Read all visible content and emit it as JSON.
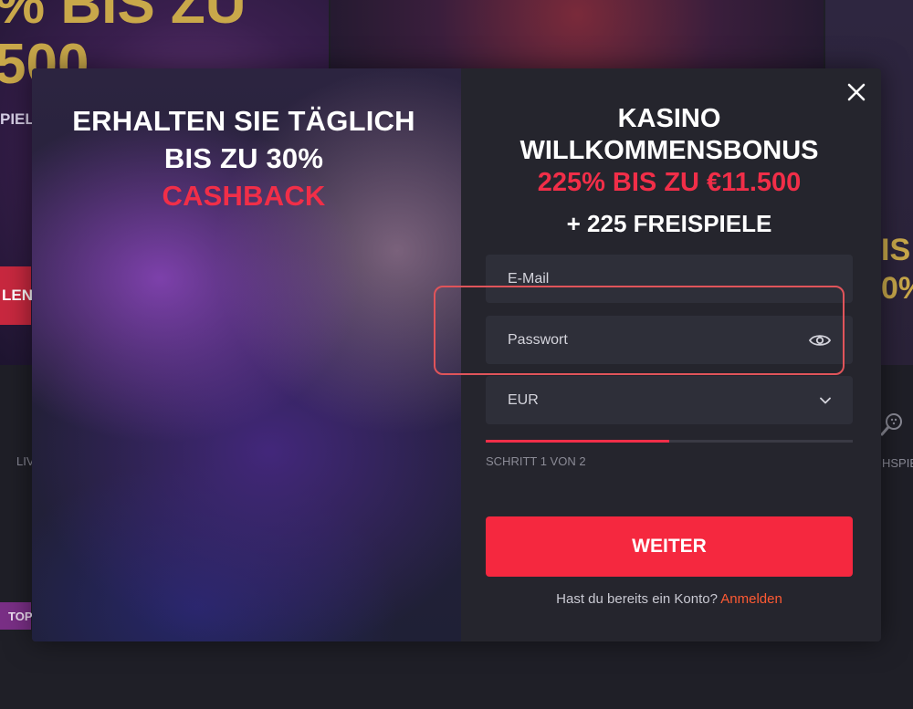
{
  "background": {
    "banner_left_text_line1": "% BIS ZU",
    "banner_left_text_line2": "500",
    "fragment_spie": "PIEL",
    "fragment_red_button": "LEN",
    "fragment_li": "LIV",
    "fragment_top": "TOP",
    "fragment_is": "IS",
    "fragment_pct": "0%",
    "fragment_hspie": "HSPIE"
  },
  "promo": {
    "line1": "ERHALTEN SIE TÄGLICH",
    "line2": "BIS ZU 30%",
    "accent": "CASHBACK"
  },
  "bonus": {
    "line1": "KASINO",
    "line2": "WILLKOMMENSBONUS",
    "accent": "225% BIS ZU €11.500",
    "spins": "+ 225 FREISPIELE"
  },
  "form": {
    "email_placeholder": "E-Mail",
    "password_placeholder": "Passwort",
    "currency_value": "EUR",
    "step_text": "SCHRITT 1 VON 2",
    "step_progress": 0.5,
    "submit_label": "WEITER",
    "login_prompt": "Hast du bereits ein Konto?",
    "login_link": "Anmelden"
  },
  "colors": {
    "accent_red": "#f12e48",
    "cta": "#f5283f",
    "link": "#ff5a33",
    "highlight_outline": "#e0545a"
  },
  "icons": {
    "close": "close-icon",
    "password_visibility": "eye-icon",
    "currency_dropdown": "chevron-down-icon"
  }
}
